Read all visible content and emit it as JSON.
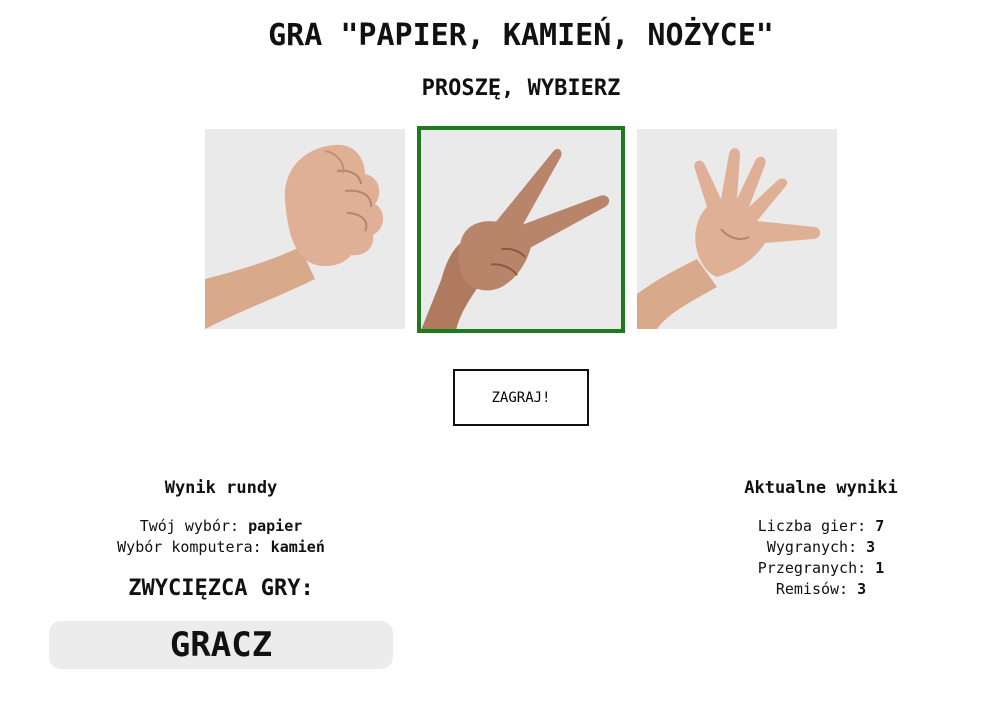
{
  "header": {
    "title": "GRA \"PAPIER, KAMIEŃ, NOŻYCE\"",
    "subtitle": "PROSZĘ, WYBIERZ"
  },
  "choices": [
    {
      "id": "kamien",
      "image": "rock-hand-fist",
      "selected": false
    },
    {
      "id": "nozyce",
      "image": "scissors-hand-v",
      "selected": true
    },
    {
      "id": "papier",
      "image": "paper-hand-open",
      "selected": false
    }
  ],
  "selection_color": "#1f7a1f",
  "play_button": {
    "label": "ZAGRAJ!"
  },
  "round_result": {
    "title": "Wynik rundy",
    "your_choice_label": "Twój wybór:",
    "your_choice_value": "papier",
    "computer_choice_label": "Wybór komputera:",
    "computer_choice_value": "kamień",
    "winner_label": "ZWYCIĘZCA GRY:",
    "winner_value": "GRACZ"
  },
  "scores": {
    "title": "Aktualne wyniki",
    "games_label": "Liczba gier:",
    "games_value": "7",
    "wins_label": "Wygranych:",
    "wins_value": "3",
    "losses_label": "Przegranych:",
    "losses_value": "1",
    "draws_label": "Remisów:",
    "draws_value": "3"
  }
}
